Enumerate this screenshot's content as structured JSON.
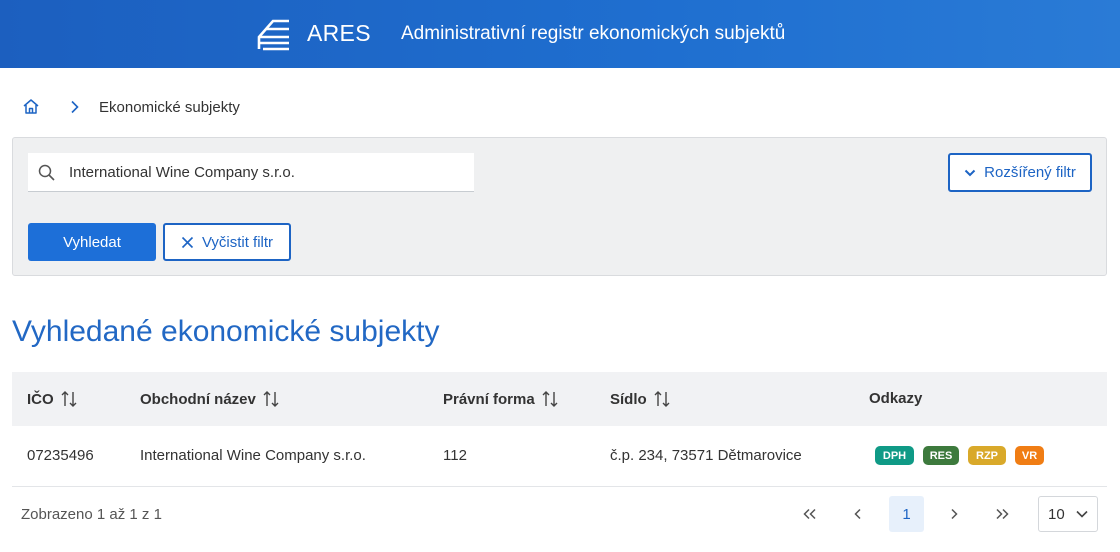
{
  "header": {
    "brand": "ARES",
    "title": "Administrativní registr ekonomických subjektů"
  },
  "breadcrumb": {
    "current": "Ekonomické subjekty"
  },
  "search": {
    "value": "International Wine Company s.r.o.",
    "advanced_filter_label": "Rozšířený filtr",
    "search_button": "Vyhledat",
    "clear_button": "Vyčistit filtr"
  },
  "results": {
    "title": "Vyhledané ekonomické subjekty",
    "columns": [
      "IČO",
      "Obchodní název",
      "Právní forma",
      "Sídlo",
      "Odkazy"
    ],
    "rows": [
      {
        "ico": "07235496",
        "name": "International Wine Company s.r.o.",
        "legal_form": "112",
        "address": "č.p. 234, 73571 Dětmarovice",
        "links": [
          {
            "label": "DPH",
            "color": "#0f9a86"
          },
          {
            "label": "RES",
            "color": "#3d7a3d"
          },
          {
            "label": "RZP",
            "color": "#d9a92a"
          },
          {
            "label": "VR",
            "color": "#f07d14"
          }
        ]
      }
    ]
  },
  "pagination": {
    "summary": "Zobrazeno 1 až 1 z 1",
    "current_page": "1",
    "page_size": "10"
  },
  "colors": {
    "header": "#1f6fd0",
    "accent": "#1d64c4",
    "primary_button": "#1d6fd8"
  }
}
